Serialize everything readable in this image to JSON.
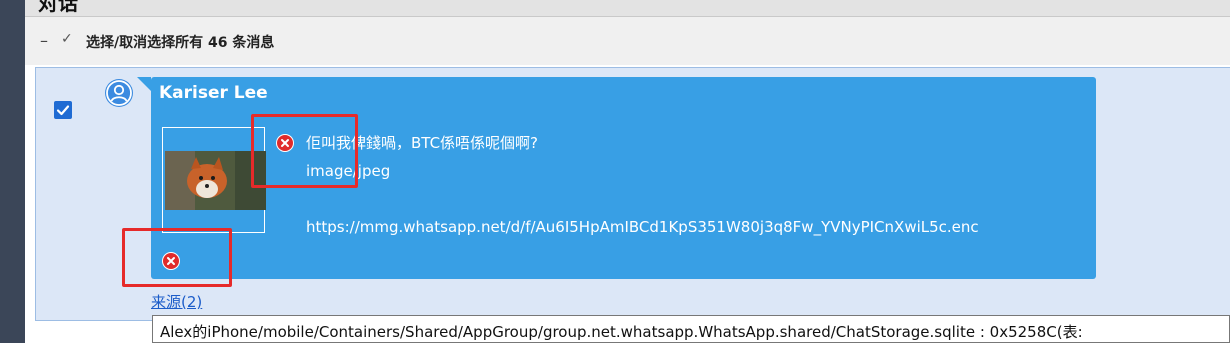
{
  "window": {
    "title": "对话"
  },
  "select_bar": {
    "dash": "–",
    "check": "✓",
    "label": "选择/取消选择所有 46 条消息"
  },
  "message": {
    "selected": true,
    "sender": "Kariser Lee",
    "text_line": "佢叫我俾錢喎，BTC係唔係呢個啊?",
    "mime_type": "image/jpeg",
    "url": "https://mmg.whatsapp.net/d/f/Au6I5HpAmIBCd1KpS351W80j3q8Fw_YVNyPICnXwiL5c.enc",
    "attachment_status_icon": "error-x-icon",
    "message_status_icon": "error-x-icon"
  },
  "source": {
    "label": "来源(2)",
    "tooltip": "Alex的iPhone/mobile/Containers/Shared/AppGroup/group.net.whatsapp.WhatsApp.shared/ChatStorage.sqlite : 0x5258C(表:"
  },
  "colors": {
    "bubble": "#389fe5",
    "panel": "#dce7f7",
    "highlight_box": "#e62a2a",
    "error_icon": "#e02b2b"
  }
}
